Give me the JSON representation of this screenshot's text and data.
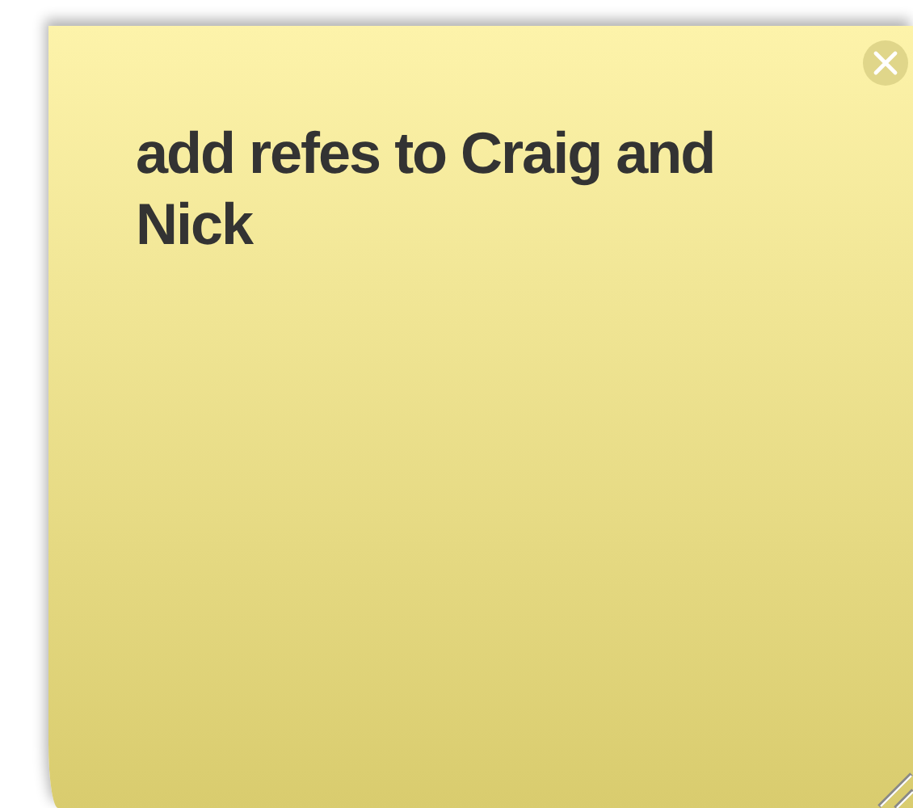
{
  "note": {
    "text": "add refes to Craig and Nick"
  }
}
